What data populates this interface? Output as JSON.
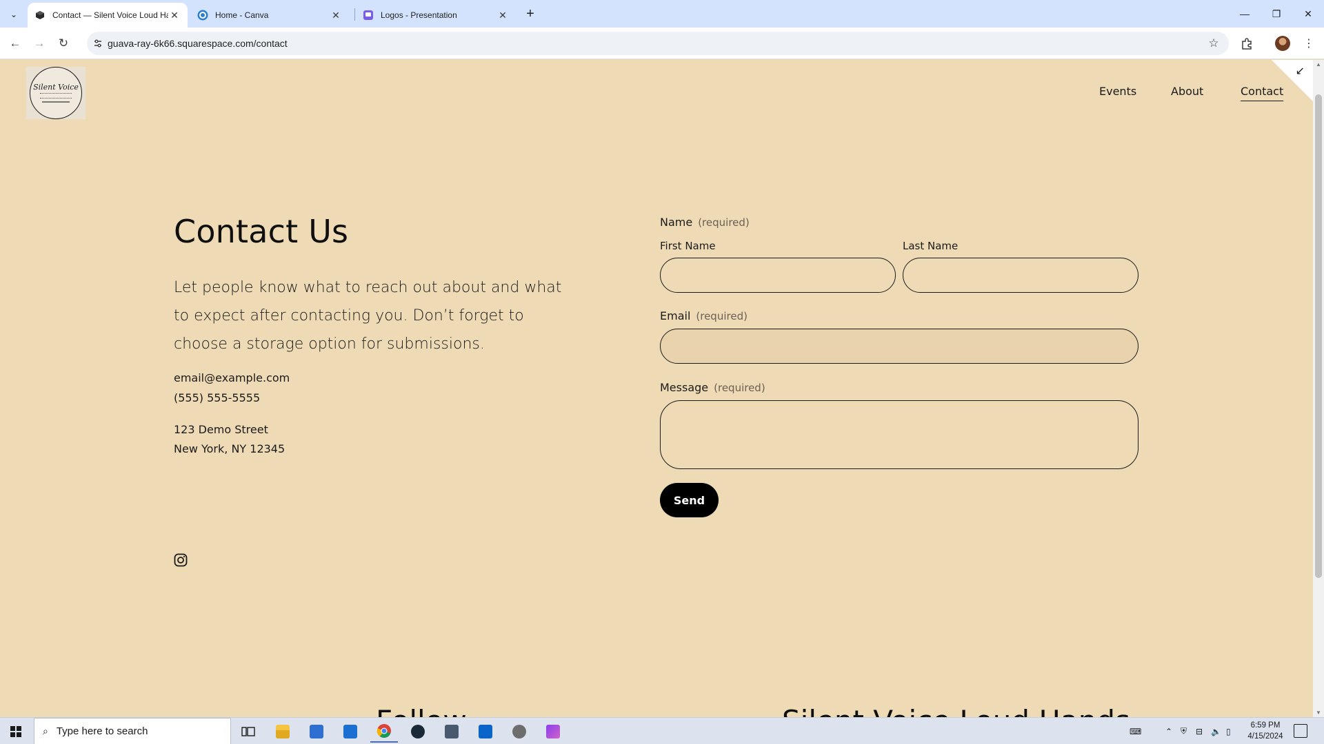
{
  "browser": {
    "tabs": [
      {
        "title": "Contact — Silent Voice Loud Ha",
        "icon": "squarespace-icon",
        "active": true
      },
      {
        "title": "Home - Canva",
        "icon": "canva-icon",
        "active": false
      },
      {
        "title": "Logos - Presentation",
        "icon": "canva-presentation-icon",
        "active": false
      }
    ],
    "new_tab": "+",
    "url": "guava-ray-6k66.squarespace.com/contact"
  },
  "site": {
    "logo_text": "Silent Voice",
    "nav": [
      {
        "label": "Events"
      },
      {
        "label": "About"
      },
      {
        "label": "Contact",
        "current": true
      }
    ]
  },
  "contact": {
    "heading": "Contact Us",
    "intro": "Let people know what to reach out about and what to expect after contacting you. Don’t forget to choose a storage option for submissions.",
    "email": "email@example.com",
    "phone": "(555) 555-5555",
    "address_line1": "123 Demo Street",
    "address_line2": "New York, NY 12345"
  },
  "form": {
    "name_label": "Name",
    "required_text": "(required)",
    "first_name_label": "First Name",
    "last_name_label": "Last Name",
    "email_label": "Email",
    "message_label": "Message",
    "send_label": "Send"
  },
  "footer": {
    "follow_heading": "Follow",
    "brand_heading": "Silent Voice Loud Hands"
  },
  "taskbar": {
    "search_placeholder": "Type here to search",
    "time": "6:59 PM",
    "date": "4/15/2024",
    "apps": [
      "task-view",
      "file-explorer",
      "microsoft-store",
      "mail",
      "chrome",
      "steam",
      "calculator",
      "outlook",
      "clock-app",
      "clipchamp"
    ]
  },
  "colors": {
    "page_background": "#eedab5",
    "text": "#1a1a1a",
    "button": "#000000",
    "tabstrip": "#d3e3fd"
  }
}
